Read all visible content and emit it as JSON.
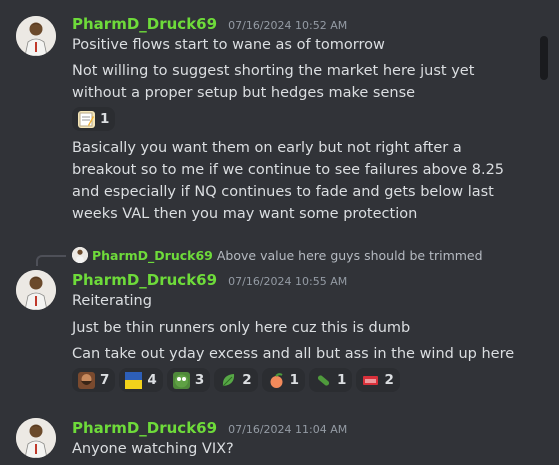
{
  "messages": [
    {
      "username": "PharmD_Druck69",
      "timestamp": "07/16/2024 10:52 AM",
      "lines": [
        "Positive flows start to wane as of tomorrow",
        "Not willing to suggest shorting the market here just yet",
        "without a proper setup but hedges make sense"
      ],
      "reaction_count": "1",
      "lines_after": [
        "Basically you want them on early but not right after a",
        "breakout so to me if we continue to see failures above 8.25",
        "and especially if NQ continues to fade and gets below last",
        "weeks VAL then you may want some protection"
      ]
    },
    {
      "reply_to": {
        "username": "PharmD_Druck69",
        "text": "Above value here guys should be trimmed"
      },
      "username": "PharmD_Druck69",
      "timestamp": "07/16/2024 10:55 AM",
      "lines": [
        "Reiterating",
        "Just be thin runners only here cuz this is dumb",
        "Can take out yday excess and all but ass in the wind up here"
      ],
      "reactions": [
        "7",
        "4",
        "3",
        "2",
        "1",
        "1",
        "2"
      ]
    },
    {
      "username": "PharmD_Druck69",
      "timestamp": "07/16/2024 11:04 AM",
      "lines": [
        "Anyone watching VIX?"
      ]
    }
  ]
}
